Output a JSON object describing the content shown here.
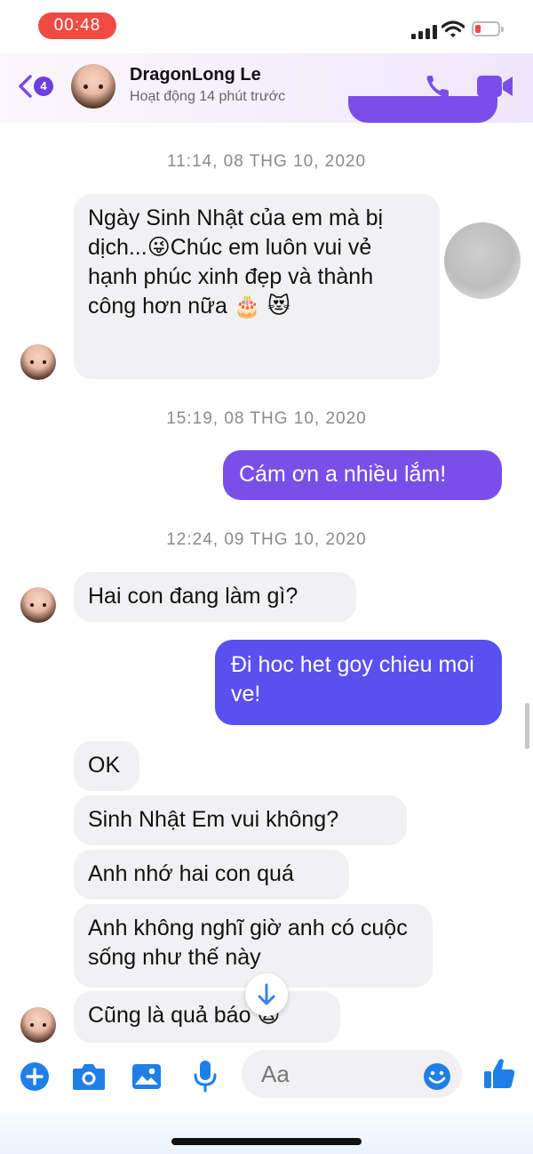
{
  "status_bar": {
    "time": "00:48"
  },
  "header": {
    "unread_count": "4",
    "contact_name": "DragonLong Le",
    "activity_status": "Hoạt động 14 phút trước",
    "accent_color": "#7a4ee8"
  },
  "timestamps": [
    "11:14, 08 THG 10, 2020",
    "15:19, 08 THG 10, 2020",
    "12:24, 09 THG 10, 2020"
  ],
  "messages": [
    {
      "direction": "in",
      "text": "Ngày Sinh Nhật của em mà bị dịch...😜Chúc em luôn vui vẻ hạnh phúc xinh đẹp và thành công hơn nữa 🎂 😻"
    },
    {
      "direction": "out",
      "text": "Cám ơn a nhiều lắm!"
    },
    {
      "direction": "in",
      "text": "Hai con đang làm gì?"
    },
    {
      "direction": "out",
      "text": "Đi hoc het goy chieu moi ve!"
    },
    {
      "direction": "in",
      "text": "OK"
    },
    {
      "direction": "in",
      "text": "Sinh Nhật Em vui không?"
    },
    {
      "direction": "in",
      "text": "Anh nhớ hai con quá"
    },
    {
      "direction": "in",
      "text": "Anh không nghĩ giờ anh có cuộc sống như thế này"
    },
    {
      "direction": "in",
      "text": "Cũng là quả báo 😨"
    }
  ],
  "composer": {
    "placeholder": "Aa"
  },
  "icons": [
    "back-chevron-icon",
    "phone-icon",
    "video-camera-icon",
    "plus-icon",
    "camera-icon",
    "image-icon",
    "microphone-icon",
    "emoji-icon",
    "thumbs-up-icon",
    "arrow-down-icon"
  ]
}
